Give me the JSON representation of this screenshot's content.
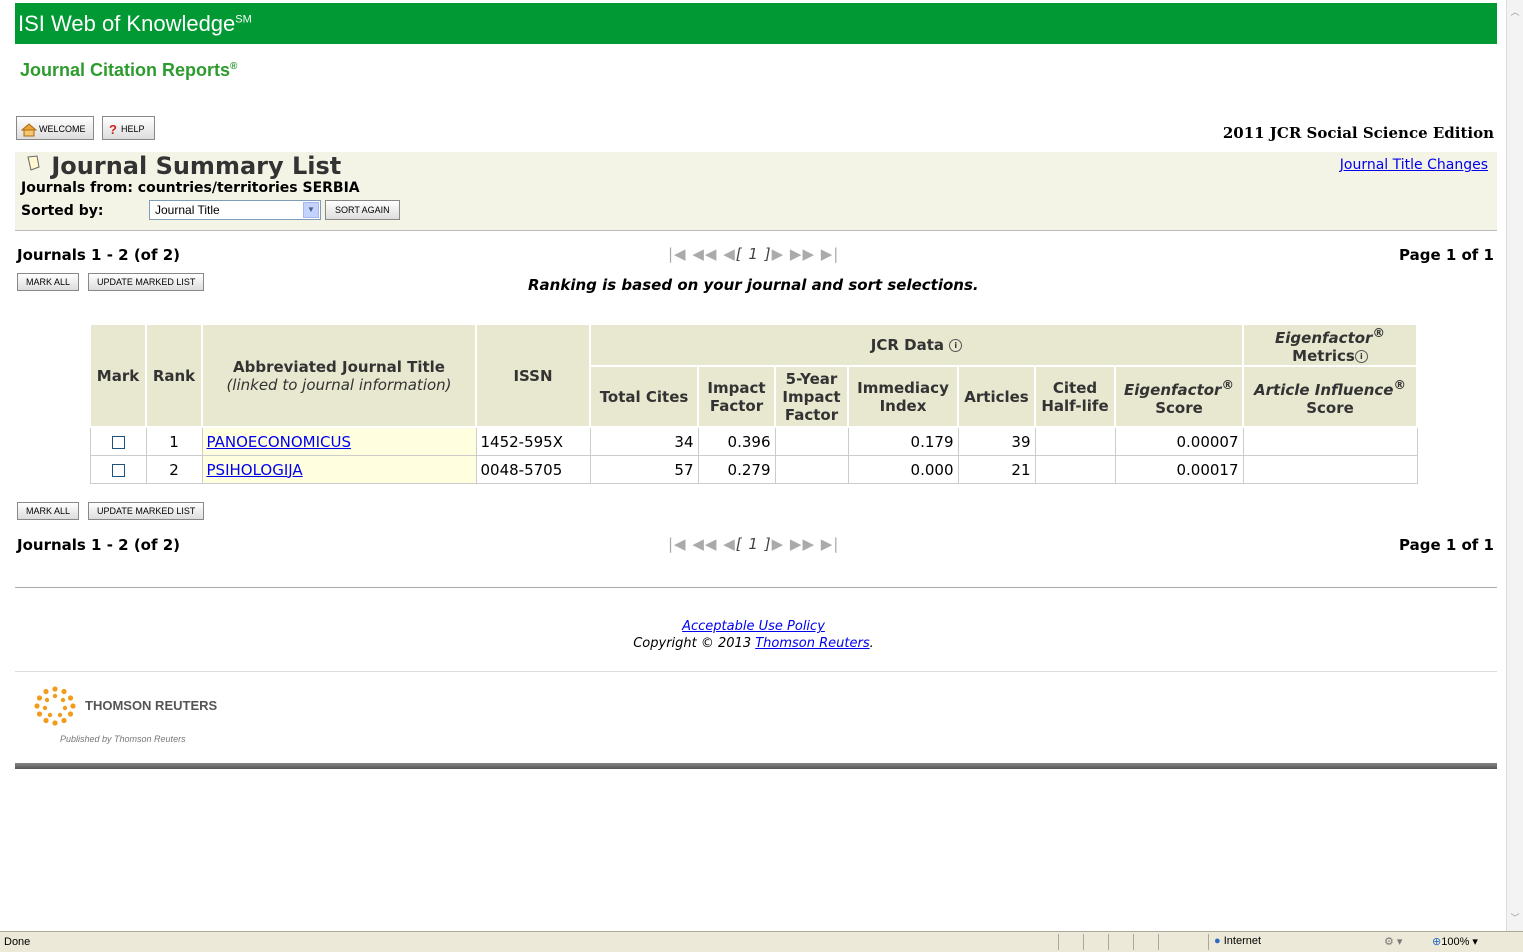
{
  "header": {
    "brand": "ISI Web of Knowledge",
    "brand_mark": "SM",
    "product": "Journal Citation Reports",
    "product_mark": "®",
    "accent_color": "#009933"
  },
  "toolbar": {
    "welcome_label": "WELCOME",
    "welcome_icon": "home-icon",
    "help_label": "HELP",
    "help_icon": "question-icon",
    "edition": "2011 JCR Social Science Edition"
  },
  "summary": {
    "heading": "Journal Summary List",
    "title_changes_link": "Journal Title Changes",
    "from_label": "Journals from:",
    "from_value": "countries/territories SERBIA",
    "sorted_label": "Sorted by:",
    "sort_value": "Journal Title",
    "sort_button": "SORT AGAIN"
  },
  "paging": {
    "range": "Journals 1 - 2 (of 2)",
    "page_of": "Page 1 of 1",
    "first": "|◀",
    "prev_many": "◀◀",
    "prev": "◀",
    "current": "[ 1 ]",
    "next": "▶",
    "next_many": "▶▶",
    "last": "▶|"
  },
  "actions": {
    "mark_all": "MARK ALL",
    "update_marked": "UPDATE MARKED LIST"
  },
  "ranking_note": "Ranking is based on your journal and sort selections.",
  "table": {
    "group_jcr": "JCR Data",
    "group_eigen": "Eigenfactor",
    "group_eigen_suffix": "Metrics",
    "col_mark": "Mark",
    "col_rank": "Rank",
    "col_title": "Abbreviated Journal Title",
    "col_title_sub": "(linked to journal information)",
    "col_issn": "ISSN",
    "col_total_cites": "Total Cites",
    "col_impact_1": "Impact",
    "col_impact_2": "Factor",
    "col_5yr_1": "5-Year",
    "col_5yr_2": "Impact",
    "col_5yr_3": "Factor",
    "col_immediacy_1": "Immediacy",
    "col_immediacy_2": "Index",
    "col_articles": "Articles",
    "col_halflife_1": "Cited",
    "col_halflife_2": "Half-life",
    "col_ef_1": "Eigenfactor",
    "col_ef_2": "Score",
    "col_ai_1": "Article Influence",
    "col_ai_2": "Score",
    "registered": "®",
    "rows": [
      {
        "rank": "1",
        "title": "PANOECONOMICUS",
        "issn": "1452-595X",
        "total_cites": "34",
        "impact": "0.396",
        "five_year": "",
        "immediacy": "0.179",
        "articles": "39",
        "half_life": "",
        "eigenfactor": "0.00007",
        "article_influence": ""
      },
      {
        "rank": "2",
        "title": "PSIHOLOGIJA",
        "issn": "0048-5705",
        "total_cites": "57",
        "impact": "0.279",
        "five_year": "",
        "immediacy": "0.000",
        "articles": "21",
        "half_life": "",
        "eigenfactor": "0.00017",
        "article_influence": ""
      }
    ]
  },
  "footer": {
    "aup": "Acceptable Use Policy",
    "copyright": "Copyright © 2013",
    "company_link": "Thomson Reuters",
    "period": ".",
    "logo_name": "THOMSON REUTERS",
    "published_by": "Published by Thomson Reuters"
  },
  "statusbar": {
    "status": "Done",
    "zone": "Internet",
    "zoom": "100%"
  }
}
